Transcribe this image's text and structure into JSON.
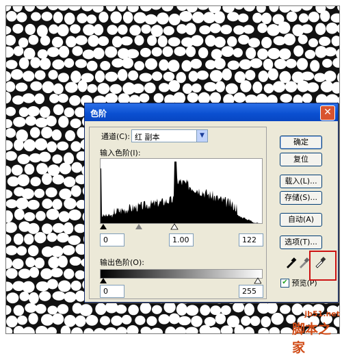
{
  "dialog": {
    "title": "色阶",
    "close_symbol": "✕",
    "channel_label": "通道(C):",
    "channel_value": "红 副本",
    "input_levels_label": "输入色阶(I):",
    "input_black": "0",
    "input_gamma": "1.00",
    "input_white": "122",
    "output_levels_label": "输出色阶(O):",
    "output_black": "0",
    "output_white": "255",
    "buttons": {
      "ok": "确定",
      "reset": "复位",
      "load": "载入(L)...",
      "save": "存储(S)...",
      "auto": "自动(A)",
      "options": "选项(T)..."
    },
    "preview_label": "预览(P)",
    "preview_checked": true
  },
  "watermark": {
    "site": "jb51.net",
    "text": "脚本之家"
  },
  "colors": {
    "titlebar": "#0a4fd0",
    "dialog_bg": "#ece9d8",
    "highlight_box": "#cc1111",
    "watermark": "#d04b16"
  }
}
